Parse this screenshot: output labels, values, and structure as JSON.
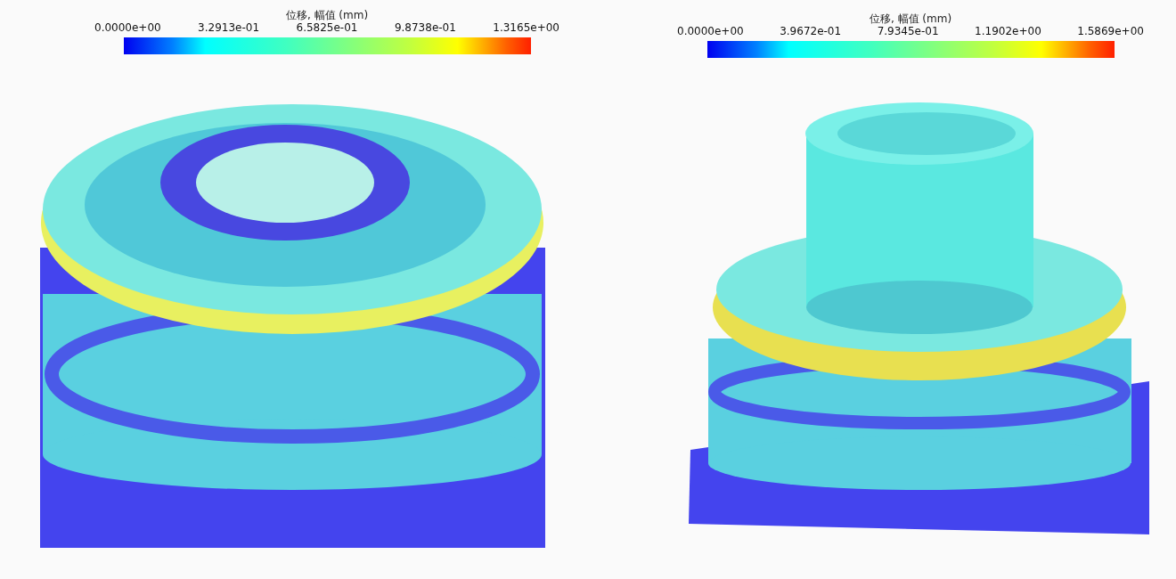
{
  "views": [
    {
      "kind": "ring",
      "legend": {
        "title": "位移, 幅值 (mm)",
        "ticks": [
          "0.0000e+00",
          "3.2913e-01",
          "6.5825e-01",
          "9.8738e-01",
          "1.3165e+00"
        ]
      }
    },
    {
      "kind": "tower",
      "legend": {
        "title": "位移, 幅值 (mm)",
        "ticks": [
          "0.0000e+00",
          "3.9672e-01",
          "7.9345e-01",
          "1.1902e+00",
          "1.5869e+00"
        ]
      }
    }
  ]
}
